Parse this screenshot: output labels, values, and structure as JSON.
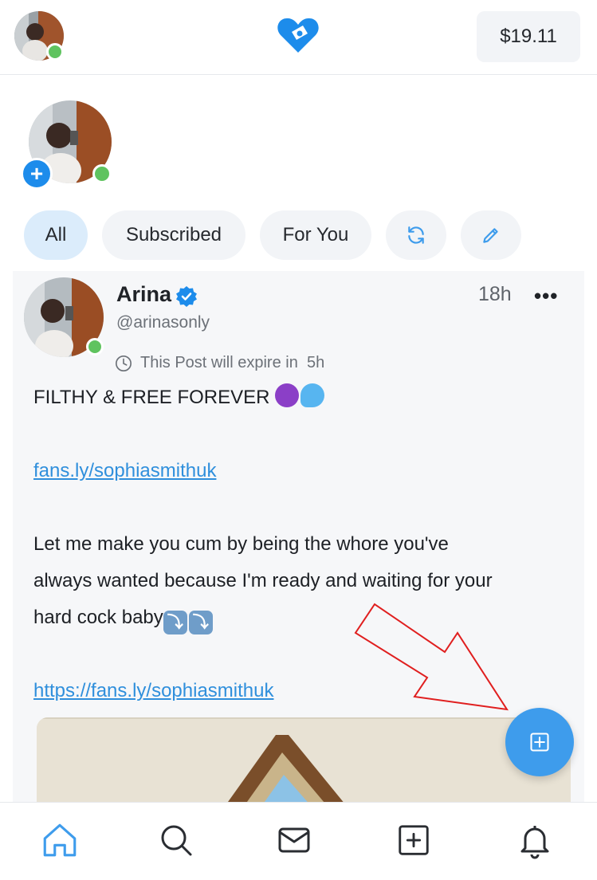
{
  "header": {
    "balance": "$19.11",
    "logo_icon": "heart-logo-icon"
  },
  "stories": {
    "add_label": "+"
  },
  "filters": [
    {
      "label": "All",
      "active": true
    },
    {
      "label": "Subscribed",
      "active": false
    },
    {
      "label": "For You",
      "active": false
    }
  ],
  "filter_icons": [
    "refresh-icon",
    "edit-pencil-icon"
  ],
  "post": {
    "author": "Arina",
    "handle": "@arinasonly",
    "time": "18h",
    "more_label": "•••",
    "expire_text": "This Post will expire in  5h",
    "line1": "FILTHY & FREE FOREVER",
    "link1": "fans.ly/sophiasmithuk",
    "line2": "Let me make you cum by being the whore you've",
    "line3": "always wanted because I'm ready and waiting for your",
    "line4": "hard cock baby",
    "link2": "https://fans.ly/sophiasmithuk"
  },
  "bottom_nav": [
    "home-icon",
    "search-icon",
    "messages-icon",
    "new-post-icon",
    "notifications-icon"
  ],
  "colors": {
    "accent": "#1d8ceb",
    "online": "#5fc35f",
    "link": "#2f8fdc",
    "annotation": "#e01f1f"
  }
}
